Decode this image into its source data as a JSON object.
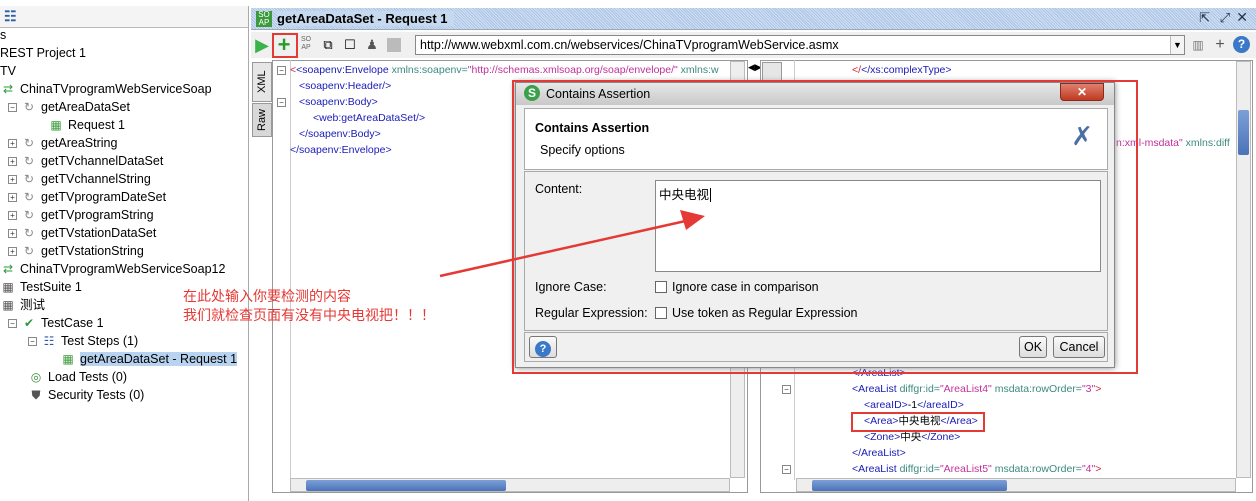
{
  "navigator": {
    "header_icon": "list-icon",
    "items": [
      {
        "label": "s",
        "icon": "none"
      },
      {
        "label": "REST Project 1",
        "icon": "none"
      },
      {
        "label": "TV",
        "icon": "none"
      },
      {
        "label": "ChinaTVprogramWebServiceSoap",
        "icon": "interface-icon"
      },
      {
        "label": "getAreaDataSet",
        "icon": "operation-icon"
      },
      {
        "label": "Request 1",
        "icon": "soap-request-icon"
      },
      {
        "label": "getAreaString",
        "icon": "operation-icon"
      },
      {
        "label": "getTVchannelDataSet",
        "icon": "operation-icon"
      },
      {
        "label": "getTVchannelString",
        "icon": "operation-icon"
      },
      {
        "label": "getTVprogramDateSet",
        "icon": "operation-icon"
      },
      {
        "label": "getTVprogramString",
        "icon": "operation-icon"
      },
      {
        "label": "getTVstationDataSet",
        "icon": "operation-icon"
      },
      {
        "label": "getTVstationString",
        "icon": "operation-icon"
      },
      {
        "label": "ChinaTVprogramWebServiceSoap12",
        "icon": "interface-icon"
      },
      {
        "label": "TestSuite 1",
        "icon": "testsuite-icon"
      },
      {
        "label": "测试",
        "icon": "testsuite-icon"
      },
      {
        "label": "TestCase 1",
        "icon": "check-icon"
      },
      {
        "label": "Test Steps (1)",
        "icon": "list-icon"
      },
      {
        "label": "getAreaDataSet - Request 1",
        "icon": "soap-request-icon",
        "selected": true
      },
      {
        "label": "Load Tests (0)",
        "icon": "load-test-icon"
      },
      {
        "label": "Security Tests (0)",
        "icon": "shield-icon"
      }
    ]
  },
  "editor": {
    "title": "getAreaDataSet - Request 1",
    "url": "http://www.webxml.com.cn/webservices/ChinaTVprogramWebService.asmx",
    "request_tabs": [
      "XML",
      "Raw"
    ],
    "request_xml": [
      {
        "tag": "<soapenv:Envelope",
        "attr": " xmlns:soapenv=",
        "val": "\"http://schemas.xmlsoap.org/soap/envelope/\"",
        "rest": " xmlns:w"
      },
      {
        "tag": "<soapenv:Header/>"
      },
      {
        "tag": "<soapenv:Body>"
      },
      {
        "tag": "<web:getAreaDataSet/>"
      },
      {
        "tag": "</soapenv:Body>"
      },
      {
        "tag": "</soapenv:Envelope>"
      }
    ],
    "response_top": {
      "line1": "</xs:complexType>",
      "line2_val": "n:xml-msdata\"",
      "line2_rest": " xmlns:diff"
    },
    "response_bottom": {
      "l0": "</AreaList>",
      "l1_tag": "<AreaList",
      "l1_a1": " diffgr:id=",
      "l1_v1": "\"AreaList4\"",
      "l1_a2": " msdata:rowOrder=",
      "l1_v2": "\"3\"",
      "l1_end": ">",
      "l2_open": "<areaID>",
      "l2_text": "-1",
      "l2_close": "</areaID>",
      "l3_open": "<Area>",
      "l3_text": "中央电视",
      "l3_close": "</Area>",
      "l4_open": "<Zone>",
      "l4_text": "中央",
      "l4_close": "</Zone>",
      "l5": "</AreaList>",
      "l6_tag": "<AreaList",
      "l6_a1": " diffgr:id=",
      "l6_v1": "\"AreaList5\"",
      "l6_a2": " msdata:rowOrder=",
      "l6_v2": "\"4\"",
      "l6_end": ">"
    }
  },
  "dialog": {
    "title": "Contains Assertion",
    "heading": "Contains Assertion",
    "subheading": "Specify options",
    "content_label": "Content:",
    "content_value": "中央电视",
    "ignore_case_label": "Ignore Case:",
    "ignore_case_text": "Ignore case in comparison",
    "ignore_case_checked": false,
    "regex_label": "Regular Expression:",
    "regex_text": "Use token as Regular Expression",
    "regex_checked": false,
    "ok": "OK",
    "cancel": "Cancel"
  },
  "annotation": {
    "line1": "在此处输入你要检测的内容",
    "line2": "我们就检查页面有没有中央电视把！！！",
    "color": "#e53935"
  }
}
